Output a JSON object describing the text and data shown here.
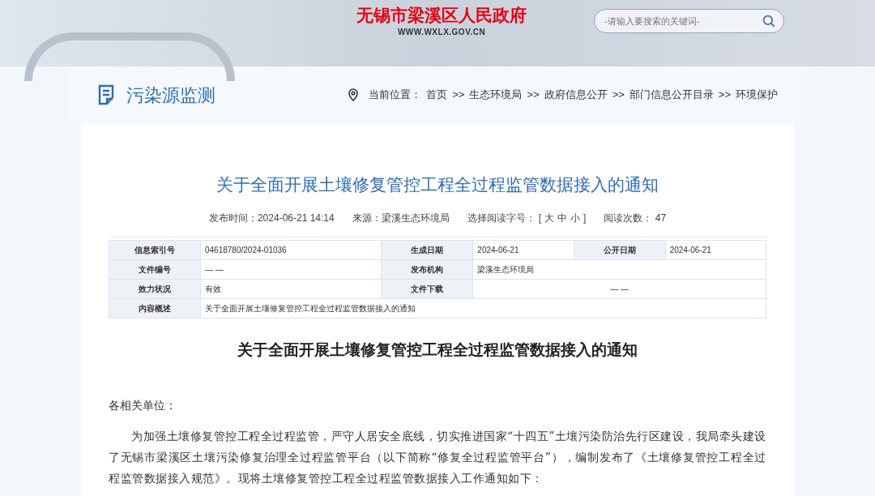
{
  "header": {
    "site_name": "无锡市梁溪区人民政府",
    "site_url": "WWW.WXLX.GOV.CN",
    "search": {
      "placeholder": "-请输入要搜索的关键词-"
    }
  },
  "section": {
    "title": "污染源监测",
    "breadcrumb": {
      "label": "当前位置：",
      "separator": ">>",
      "items": [
        "首页",
        "生态环境局",
        "政府信息公开",
        "部门信息公开目录",
        "环境保护"
      ]
    }
  },
  "article": {
    "title": "关于全面开展土壤修复管控工程全过程监管数据接入的通知",
    "meta": {
      "published": "发布时间：2024-06-21 14:14",
      "source": "来源：梁溪生态环境局",
      "font_size": {
        "label": "选择阅读字号：",
        "open": "[",
        "options": [
          "大",
          "中",
          "小"
        ],
        "close": "]"
      },
      "views": "阅读次数： 47"
    },
    "info_table": [
      [
        {
          "kind": "label",
          "text": "信息索引号"
        },
        {
          "kind": "value",
          "text": "04618780/2024-01036"
        },
        {
          "kind": "label",
          "text": "生成日期"
        },
        {
          "kind": "value",
          "text": "2024-06-21"
        },
        {
          "kind": "label",
          "text": "公开日期"
        },
        {
          "kind": "value",
          "text": "2024-06-21"
        }
      ],
      [
        {
          "kind": "label",
          "text": "文件编号"
        },
        {
          "kind": "value",
          "text": "— —"
        },
        {
          "kind": "label",
          "text": "发布机构"
        },
        {
          "kind": "value",
          "text": "梁溪生态环境局"
        }
      ],
      [
        {
          "kind": "label",
          "text": "效力状况"
        },
        {
          "kind": "value",
          "text": "有效"
        },
        {
          "kind": "label",
          "text": "文件下载"
        },
        {
          "kind": "centered",
          "text": "— —"
        }
      ],
      [
        {
          "kind": "label",
          "text": "内容概述"
        },
        {
          "kind": "value",
          "text": "关于全面开展土壤修复管控工程全过程监管数据接入的通知"
        }
      ]
    ],
    "body_title": "关于全面开展土壤修复管控工程全过程监管数据接入的通知",
    "salutation": "各相关单位：",
    "paragraphs": [
      "为加强土壤修复管控工程全过程监管，严守人居安全底线，切实推进国家“十四五”土壤污染防治先行区建设，我局牵头建设了无锡市梁溪区土壤污染修复治理全过程监管平台（以下简称“修复全过程监管平台”），编制发布了《土壤修复管控工程全过程监管数据接入规范》。现将土壤修复管控工程全过程监管数据接入工作通知如下："
    ]
  }
}
